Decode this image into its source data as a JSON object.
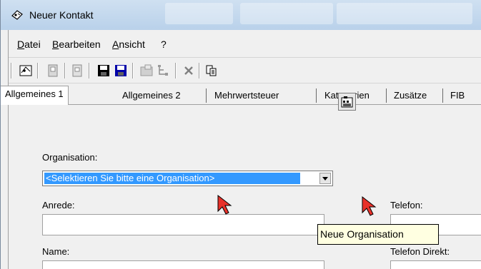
{
  "window": {
    "title": "Neuer Kontakt"
  },
  "menu": {
    "items": [
      {
        "mnemonic": "D",
        "rest": "atei"
      },
      {
        "mnemonic": "B",
        "rest": "earbeiten"
      },
      {
        "mnemonic": "A",
        "rest": "nsicht"
      },
      {
        "mnemonic": "",
        "rest": "?"
      }
    ]
  },
  "toolbar": {
    "icons": [
      "new-contact-icon",
      "card-icon",
      "document-icon",
      "save-icon",
      "save-as-icon",
      "properties-icon",
      "tree-icon",
      "delete-icon",
      "copy-icon"
    ]
  },
  "tabs": [
    "Allgemeines 1",
    "Allgemeines 2",
    "Mehrwertsteuer",
    "Kategorien",
    "Zusätze",
    "FIB"
  ],
  "form": {
    "organisation_label": "Organisation:",
    "organisation_value": "<Selektieren Sie bitte eine Organisation>",
    "anrede_label": "Anrede:",
    "name_label": "Name:",
    "telefon_label": "Telefon:",
    "telefon_direkt_label": "Telefon Direkt:",
    "tooltip": "Neue Organisation"
  },
  "colors": {
    "selection": "#3399ff",
    "pointer": "#e8312a",
    "tooltip_bg": "#ffffe1"
  }
}
